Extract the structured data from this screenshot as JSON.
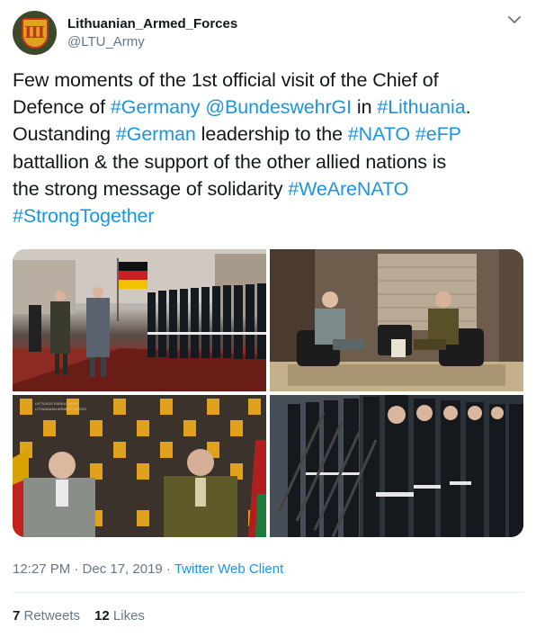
{
  "author": {
    "display_name": "Lithuanian_Armed_Forces",
    "handle": "@LTU_Army",
    "avatar_icon": "lithuanian-armed-forces-emblem"
  },
  "menu": {
    "icon": "chevron-down-icon"
  },
  "tweet": {
    "lines": [
      [
        {
          "t": "Few moments of the 1st official visit of the Chief of"
        }
      ],
      [
        {
          "t": "Defence of "
        },
        {
          "t": "#Germany",
          "tag": true
        },
        {
          "t": " "
        },
        {
          "t": "@BundeswehrGI",
          "tag": true
        },
        {
          "t": " in "
        },
        {
          "t": "#Lithuania",
          "tag": true
        },
        {
          "t": "."
        }
      ],
      [
        {
          "t": "Oustanding "
        },
        {
          "t": "#German",
          "tag": true
        },
        {
          "t": " leadership to the "
        },
        {
          "t": "#NATO",
          "tag": true
        },
        {
          "t": " "
        },
        {
          "t": "#eFP",
          "tag": true
        }
      ],
      [
        {
          "t": "battallion & the support of the other allied nations is"
        }
      ],
      [
        {
          "t": "the strong message of solidarity "
        },
        {
          "t": "#WeAreNATO",
          "tag": true
        }
      ],
      [
        {
          "t": "#StrongTogether",
          "tag": true
        }
      ]
    ]
  },
  "media": {
    "photos": [
      {
        "name": "photo-honor-guard-review",
        "banner_text": ""
      },
      {
        "name": "photo-meeting-armchairs"
      },
      {
        "name": "photo-press-conference",
        "banner_text": "LIETUVOS KARIUOMENĖ",
        "banner_text_2": "LITHUANIAN ARMED FORCES"
      },
      {
        "name": "photo-soldiers-rifles"
      }
    ]
  },
  "footer": {
    "time": "12:27 PM · Dec 17, 2019 · ",
    "client": "Twitter Web Client",
    "retweets_count": "7",
    "retweets_label": " Retweets",
    "likes_count": "12",
    "likes_label": " Likes"
  },
  "colors": {
    "link": "#1b95e0",
    "secondary": "#657786",
    "divider": "#e6ecf0"
  }
}
